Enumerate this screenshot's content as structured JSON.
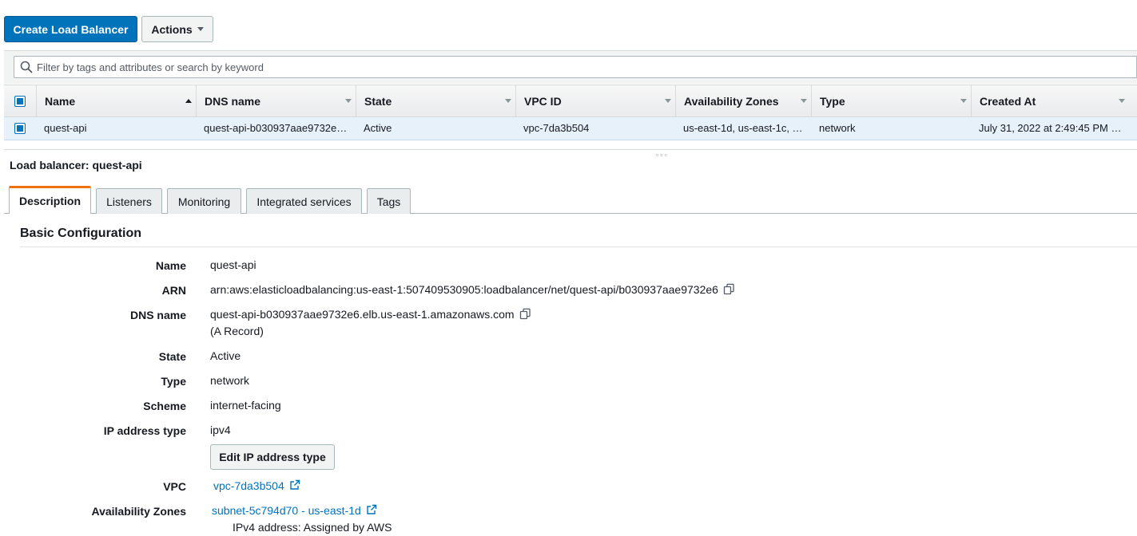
{
  "toolbar": {
    "create_label": "Create Load Balancer",
    "actions_label": "Actions"
  },
  "search": {
    "placeholder": "Filter by tags and attributes or search by keyword"
  },
  "table": {
    "columns": [
      "Name",
      "DNS name",
      "State",
      "VPC ID",
      "Availability Zones",
      "Type",
      "Created At"
    ],
    "sorted_column": "Name",
    "sort_direction": "ascending",
    "rows": [
      {
        "selected": true,
        "name": "quest-api",
        "dns_name": "quest-api-b030937aae9732e…",
        "state": "Active",
        "vpc_id": "vpc-7da3b504",
        "availability_zones": "us-east-1d, us-east-1c, …",
        "type": "network",
        "created_at": "July 31, 2022 at 2:49:45 PM …"
      }
    ]
  },
  "details": {
    "title": "Load balancer: quest-api",
    "tabs": [
      "Description",
      "Listeners",
      "Monitoring",
      "Integrated services",
      "Tags"
    ],
    "active_tab": "Description",
    "section_title": "Basic Configuration",
    "fields": {
      "name": {
        "label": "Name",
        "value": "quest-api"
      },
      "arn": {
        "label": "ARN",
        "value": "arn:aws:elasticloadbalancing:us-east-1:507409530905:loadbalancer/net/quest-api/b030937aae9732e6"
      },
      "dns_name": {
        "label": "DNS name",
        "value": "quest-api-b030937aae9732e6.elb.us-east-1.amazonaws.com",
        "note": "(A Record)"
      },
      "state": {
        "label": "State",
        "value": "Active"
      },
      "type": {
        "label": "Type",
        "value": "network"
      },
      "scheme": {
        "label": "Scheme",
        "value": "internet-facing"
      },
      "ip_address_type": {
        "label": "IP address type",
        "value": "ipv4",
        "edit_button": "Edit IP address type"
      },
      "vpc": {
        "label": "VPC",
        "value": "vpc-7da3b504"
      },
      "availability_zones": {
        "label": "Availability Zones",
        "value": "subnet-5c794d70 - us-east-1d",
        "ipv4": "IPv4 address: Assigned by AWS"
      }
    }
  },
  "colors": {
    "primary": "#0073bb",
    "tab_accent": "#ec7211",
    "selected_row": "#e6f1fa"
  },
  "icons": {
    "search": "search-icon",
    "copy": "copy-icon",
    "external_link": "external-link-icon",
    "dropdown": "chevron-down-icon"
  }
}
